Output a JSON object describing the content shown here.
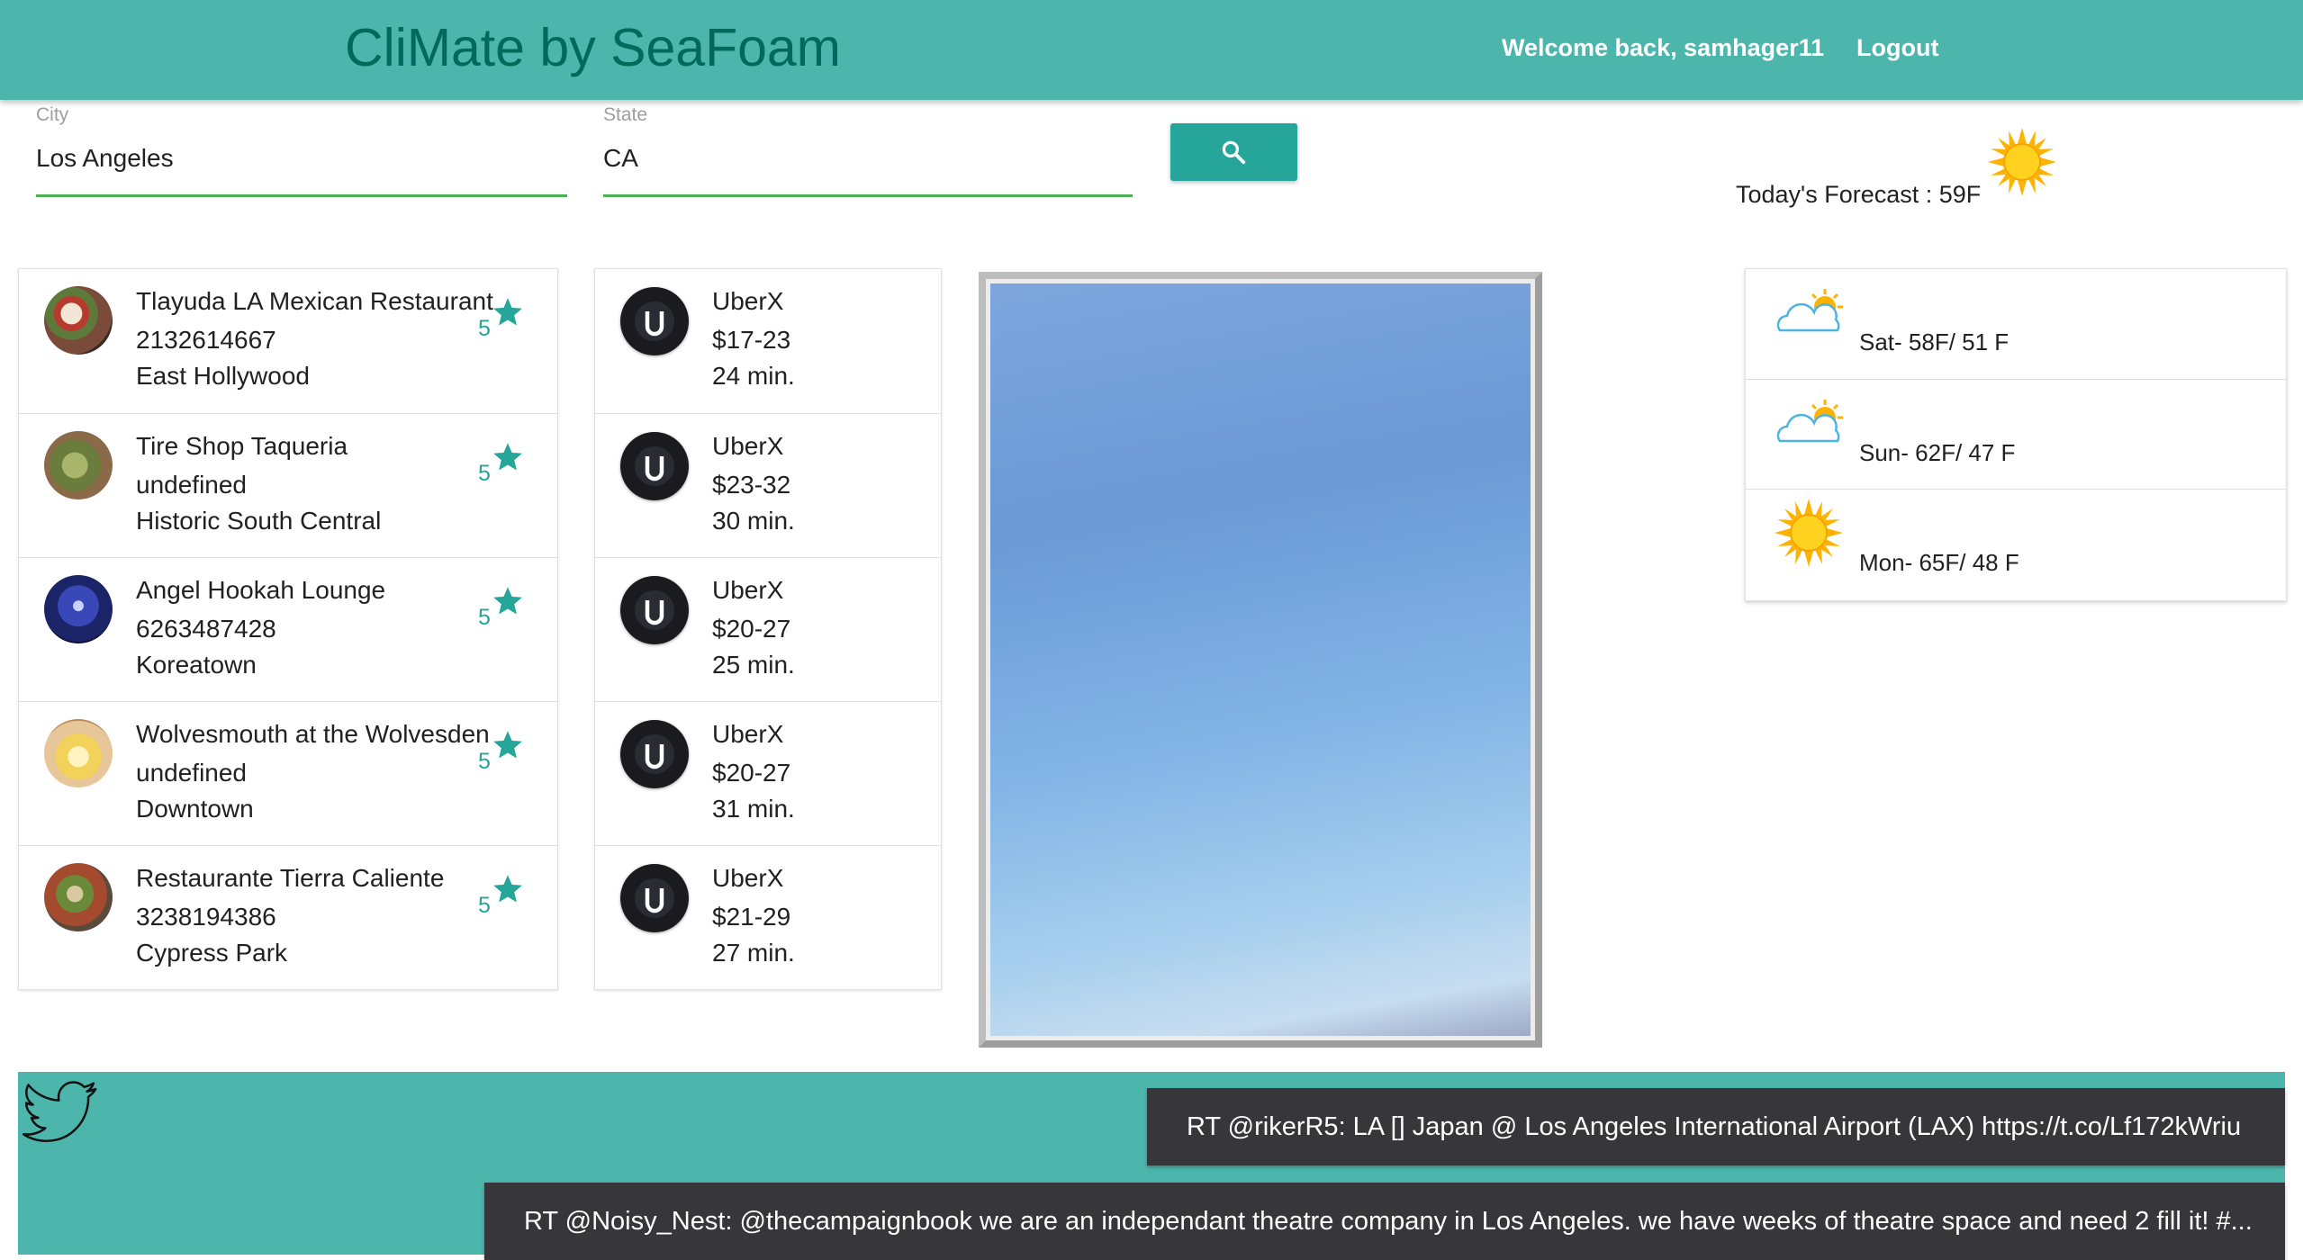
{
  "header": {
    "brand": "CliMate by SeaFoam",
    "welcome": "Welcome back, samhager11",
    "logout": "Logout"
  },
  "search": {
    "city_label": "City",
    "city_value": "Los Angeles",
    "state_label": "State",
    "state_value": "CA",
    "button_icon": "search-icon"
  },
  "forecast_today": "Today's Forecast : 59F",
  "restaurants": [
    {
      "name": "Tlayuda LA Mexican Restaurant",
      "phone": "2132614667",
      "area": "East Hollywood",
      "rating": "5"
    },
    {
      "name": "Tire Shop Taqueria",
      "phone": "undefined",
      "area": "Historic South Central",
      "rating": "5"
    },
    {
      "name": "Angel Hookah Lounge",
      "phone": "6263487428",
      "area": "Koreatown",
      "rating": "5"
    },
    {
      "name": "Wolvesmouth at the Wolvesden",
      "phone": "undefined",
      "area": "Downtown",
      "rating": "5"
    },
    {
      "name": "Restaurante Tierra Caliente",
      "phone": "3238194386",
      "area": "Cypress Park",
      "rating": "5"
    }
  ],
  "rides": [
    {
      "type": "UberX",
      "price": "$17-23",
      "eta": "24 min."
    },
    {
      "type": "UberX",
      "price": "$23-32",
      "eta": "30 min."
    },
    {
      "type": "UberX",
      "price": "$20-27",
      "eta": "25 min."
    },
    {
      "type": "UberX",
      "price": "$20-27",
      "eta": "31 min."
    },
    {
      "type": "UberX",
      "price": "$21-29",
      "eta": "27 min."
    }
  ],
  "weather": [
    {
      "text": "Sat- 58F/ 51 F",
      "icon": "partly-cloudy-icon"
    },
    {
      "text": "Sun- 62F/ 47 F",
      "icon": "partly-cloudy-icon"
    },
    {
      "text": "Mon- 65F/ 48 F",
      "icon": "sun-icon"
    }
  ],
  "tweets": [
    "RT @rikerR5: LA [] Japan @ Los Angeles International Airport (LAX) https://t.co/Lf172kWriu",
    "RT @Noisy_Nest: @thecampaignbook we are an independant theatre company in Los Angeles. we have weeks of theatre space and need 2 fill it! #..."
  ],
  "colors": {
    "header": "#4db6ac",
    "brand_text": "#00695c",
    "accent": "#26a69a",
    "underline": "#4caf50",
    "tweet_bg": "#37363a"
  }
}
